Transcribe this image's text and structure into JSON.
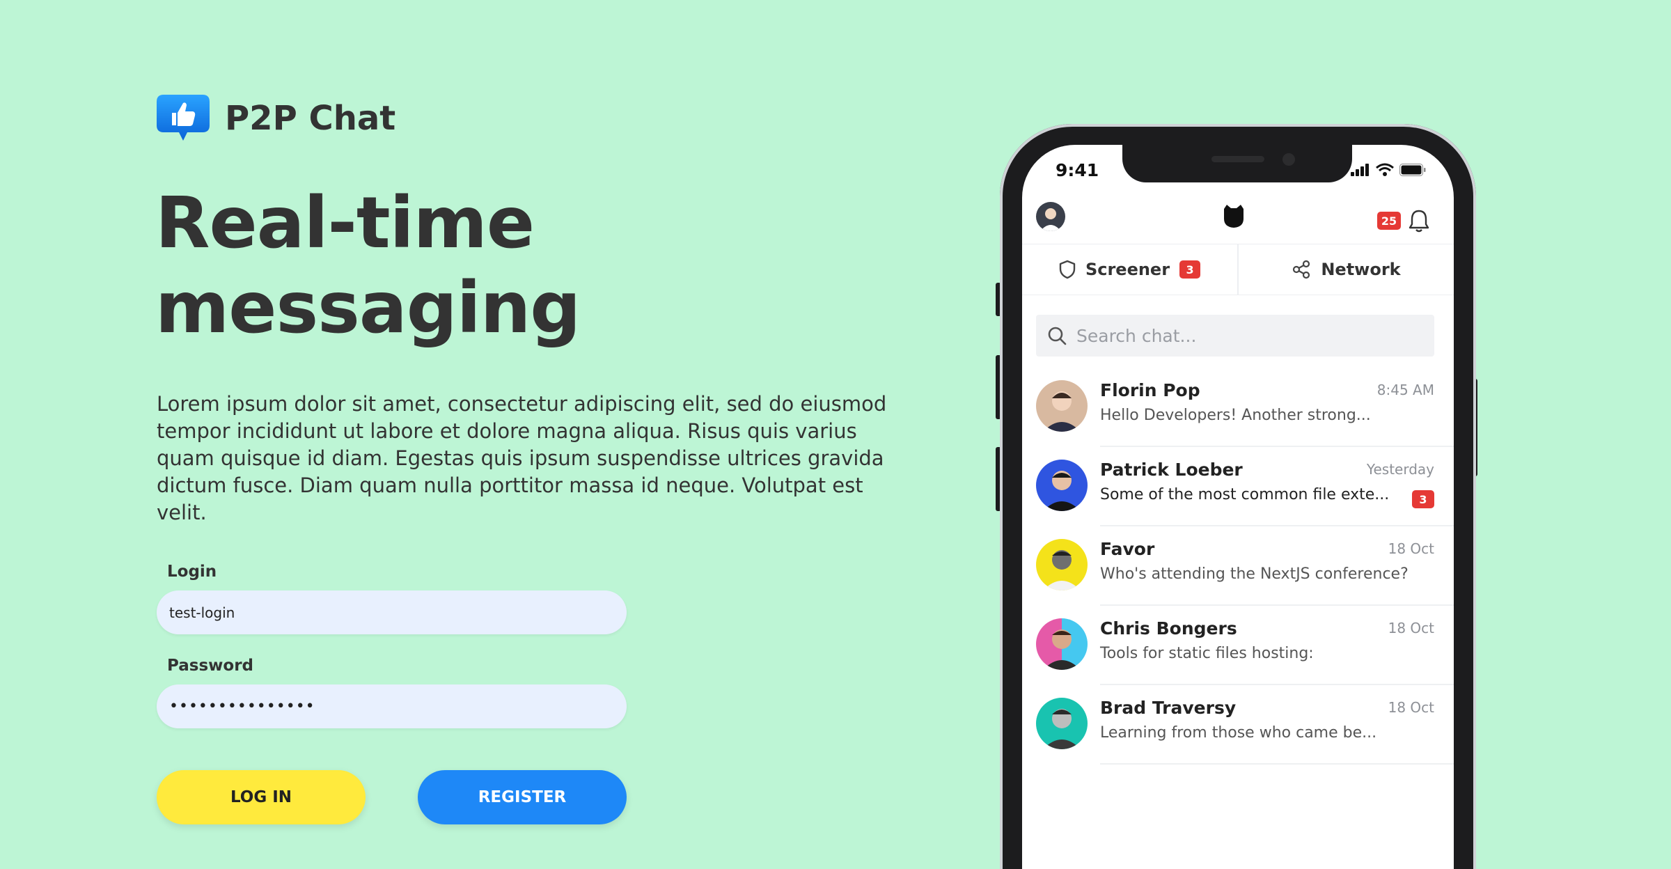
{
  "app": {
    "name": "P2P Chat",
    "headline": [
      "Real-time",
      "messaging"
    ],
    "description": "Lorem ipsum dolor sit amet, consectetur adipiscing elit, sed do eiusmod tempor incididunt ut labore et dolore magna aliqua. Risus quis varius quam quisque id diam. Egestas quis ipsum suspendisse ultrices gravida dictum fusce. Diam quam nulla porttitor massa id neque. Volutpat est velit."
  },
  "form": {
    "login_label": "Login",
    "login_value": "test-login",
    "password_label": "Password",
    "password_value": "•••••••••••••••",
    "login_button": "LOG IN",
    "register_button": "REGISTER"
  },
  "phone": {
    "status_time": "9:41",
    "notification_count": "25",
    "tabs": [
      {
        "label": "Screener",
        "badge": "3",
        "icon": "shield-icon"
      },
      {
        "label": "Network",
        "icon": "share-icon"
      }
    ],
    "search_placeholder": "Search chat...",
    "chats": [
      {
        "name": "Florin Pop",
        "time": "8:45 AM",
        "message": "Hello Developers! Another strong...",
        "avatar_color": "#d8b9a0"
      },
      {
        "name": "Patrick Loeber",
        "time": "Yesterday",
        "message": "Some of the most common file exte...",
        "badge": "3",
        "avatar_color": "#2f55e0"
      },
      {
        "name": "Favor",
        "time": "18 Oct",
        "message": "Who's attending the NextJS conference?",
        "avatar_color": "#f4e21a"
      },
      {
        "name": "Chris Bongers",
        "time": "18 Oct",
        "message": "Tools for static files hosting:",
        "avatar_color": "#e55aa8"
      },
      {
        "name": "Brad Traversy",
        "time": "18 Oct",
        "message": "Learning from those who came be...",
        "avatar_color": "#19c3b0"
      }
    ]
  },
  "colors": {
    "background": "#bdf5d5",
    "login_button": "#ffea3d",
    "register_button": "#1e88f7",
    "input_bg": "#e8f0fe",
    "badge": "#e53935"
  }
}
